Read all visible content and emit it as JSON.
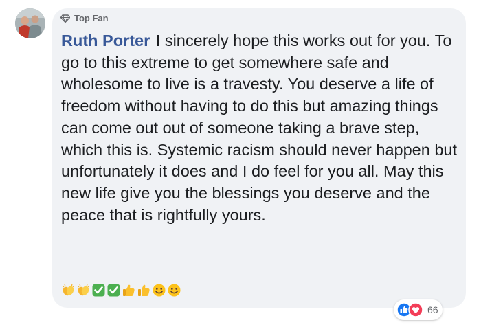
{
  "comment": {
    "badge_label": "Top Fan",
    "badge_icon": "diamond-icon",
    "author": "Ruth Porter",
    "text": "I sincerely hope this works out for you. To go to this extreme to get somewhere safe and wholesome to live is a travesty. You deserve a life of freedom without having to do this but amazing things can come out out of someone taking a brave step, which this is. Systemic racism should never happen but unfortunately it does and I do feel for you all. May this new life give you the blessings you deserve and the peace that is rightfully yours.",
    "emojis": [
      "clapping-hands",
      "clapping-hands",
      "check-mark-button",
      "check-mark-button",
      "thumbs-up",
      "thumbs-up",
      "smiling-face",
      "smiling-face"
    ]
  },
  "reactions": {
    "icons": [
      "like-icon",
      "love-icon"
    ],
    "count": "66"
  },
  "colors": {
    "author": "#385898",
    "text": "#1c1e21",
    "bubble": "#f0f2f5",
    "meta": "#65676b",
    "like": "#1877f2",
    "love": "#f33e58"
  }
}
